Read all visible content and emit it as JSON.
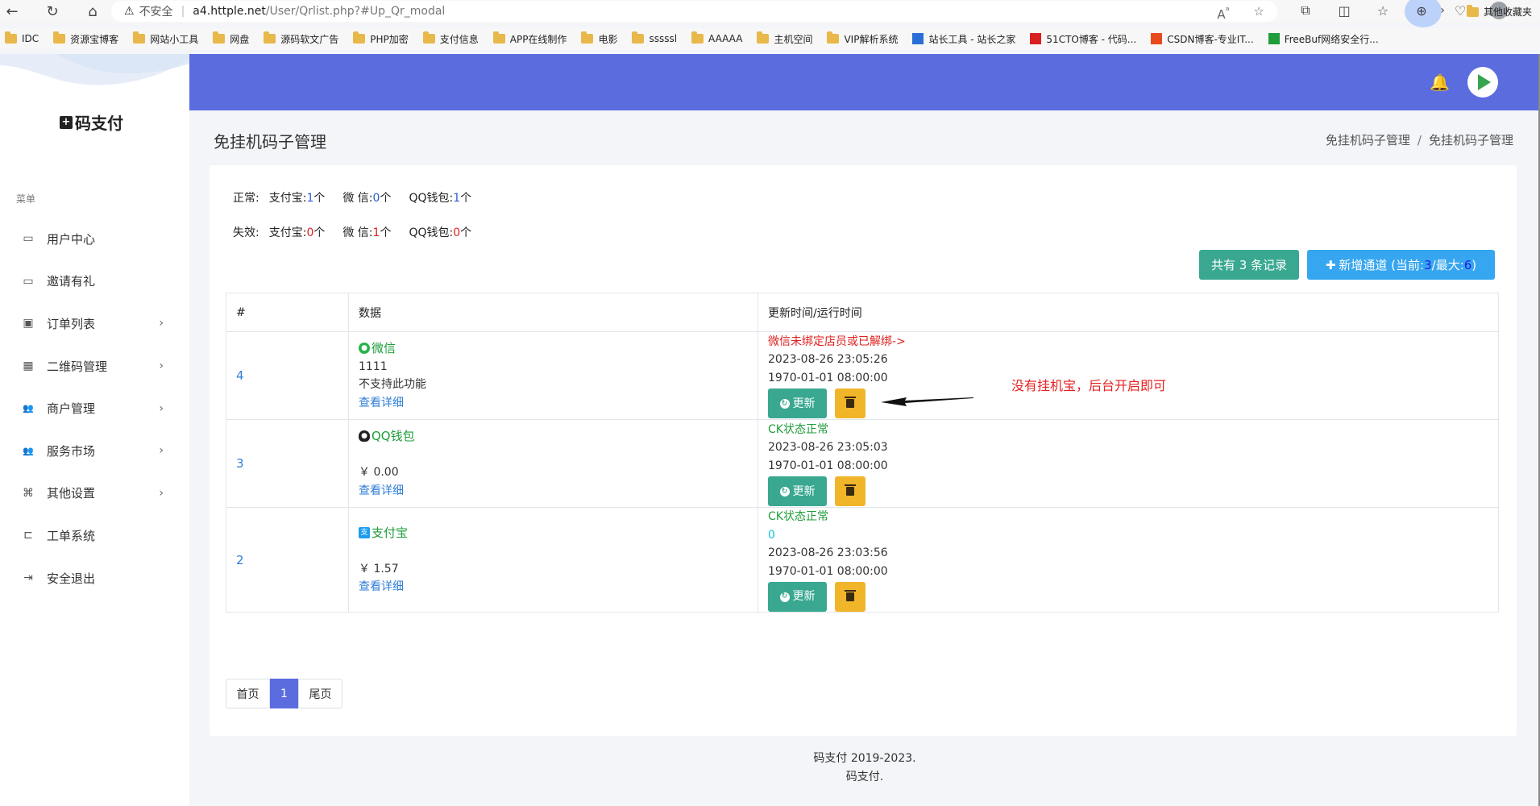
{
  "browser": {
    "insecure_label": "不安全",
    "url_host": "a4.httple.net",
    "url_path": "/User/Qrlist.php?#Up_Qr_modal"
  },
  "bookmarks": [
    {
      "label": "IDC",
      "kind": "folder"
    },
    {
      "label": "资源宝博客",
      "kind": "folder"
    },
    {
      "label": "网站小工具",
      "kind": "folder"
    },
    {
      "label": "网盘",
      "kind": "folder"
    },
    {
      "label": "源码软文广告",
      "kind": "folder"
    },
    {
      "label": "PHP加密",
      "kind": "folder"
    },
    {
      "label": "支付信息",
      "kind": "folder"
    },
    {
      "label": "APP在线制作",
      "kind": "folder"
    },
    {
      "label": "电影",
      "kind": "folder"
    },
    {
      "label": "sssssl",
      "kind": "folder"
    },
    {
      "label": "AAAAA",
      "kind": "folder"
    },
    {
      "label": "主机空间",
      "kind": "folder"
    },
    {
      "label": "VIP解析系统",
      "kind": "folder"
    },
    {
      "label": "站长工具 - 站长之家",
      "kind": "site"
    },
    {
      "label": "51CTO博客 - 代码...",
      "kind": "site"
    },
    {
      "label": "CSDN博客-专业IT...",
      "kind": "site"
    },
    {
      "label": "FreeBuf网络安全行...",
      "kind": "site"
    }
  ],
  "bookmarks_other": "其他收藏夹",
  "sidebar": {
    "brand": "码支付",
    "menu_title": "菜单",
    "items": [
      {
        "label": "用户中心",
        "icon": "monitor-icon",
        "has_submenu": false
      },
      {
        "label": "邀请有礼",
        "icon": "monitor-icon",
        "has_submenu": false
      },
      {
        "label": "订单列表",
        "icon": "money-icon",
        "has_submenu": true
      },
      {
        "label": "二维码管理",
        "icon": "qr-icon",
        "has_submenu": true
      },
      {
        "label": "商户管理",
        "icon": "users-icon",
        "has_submenu": true
      },
      {
        "label": "服务市场",
        "icon": "users-icon",
        "has_submenu": true
      },
      {
        "label": "其他设置",
        "icon": "command-icon",
        "has_submenu": true
      },
      {
        "label": "工单系统",
        "icon": "ticket-icon",
        "has_submenu": false
      },
      {
        "label": "安全退出",
        "icon": "logout-icon",
        "has_submenu": false
      }
    ]
  },
  "page": {
    "title": "免挂机码子管理",
    "breadcrumb": [
      "免挂机码子管理",
      "免挂机码子管理"
    ]
  },
  "stats": {
    "normal_label": "正常:",
    "invalid_label": "失效:",
    "normal": {
      "alipay": "1",
      "wechat": "0",
      "qq": "1"
    },
    "invalid": {
      "alipay": "0",
      "wechat": "1",
      "qq": "0"
    },
    "alipay_label": "支付宝:",
    "wechat_label": "微 信:",
    "qq_label": "QQ钱包:",
    "unit": "个"
  },
  "actions": {
    "records_label": "共有 3 条记录",
    "add_prefix": "新增通道 (当前:",
    "add_current": "3",
    "add_mid": "/最大:",
    "add_max": "6",
    "add_suffix": ")"
  },
  "table": {
    "headers": [
      "#",
      "数据",
      "更新时间/运行时间"
    ],
    "rows": [
      {
        "id": "4",
        "pay_type": "微信",
        "line1": "1111",
        "line2": "不支持此功能",
        "detail": "查看详细",
        "status": "微信未绑定店员或已解绑->",
        "extra": "",
        "updated": "2023-08-26 23:05:26",
        "runtime": "1970-01-01 08:00:00"
      },
      {
        "id": "3",
        "pay_type": "QQ钱包",
        "line1": "",
        "line2": "￥ 0.00",
        "detail": "查看详细",
        "status": "CK状态正常",
        "extra": "",
        "updated": "2023-08-26 23:05:03",
        "runtime": "1970-01-01 08:00:00"
      },
      {
        "id": "2",
        "pay_type": "支付宝",
        "line1": "",
        "line2": "￥ 1.57",
        "detail": "查看详细",
        "status": "CK状态正常",
        "extra": "0",
        "updated": "2023-08-26 23:03:56",
        "runtime": "1970-01-01 08:00:00"
      }
    ],
    "update_label": "更新"
  },
  "annotation": "没有挂机宝，后台开启即可",
  "pagination": {
    "first": "首页",
    "current": "1",
    "last": "尾页"
  },
  "footer": {
    "line1": "码支付 2019-2023.",
    "line2": "码支付."
  },
  "colors": {
    "primary": "#5b6cdf",
    "success": "#3aa891",
    "info": "#36a6f0",
    "warning": "#f1b52a",
    "danger": "#e01f1f"
  }
}
